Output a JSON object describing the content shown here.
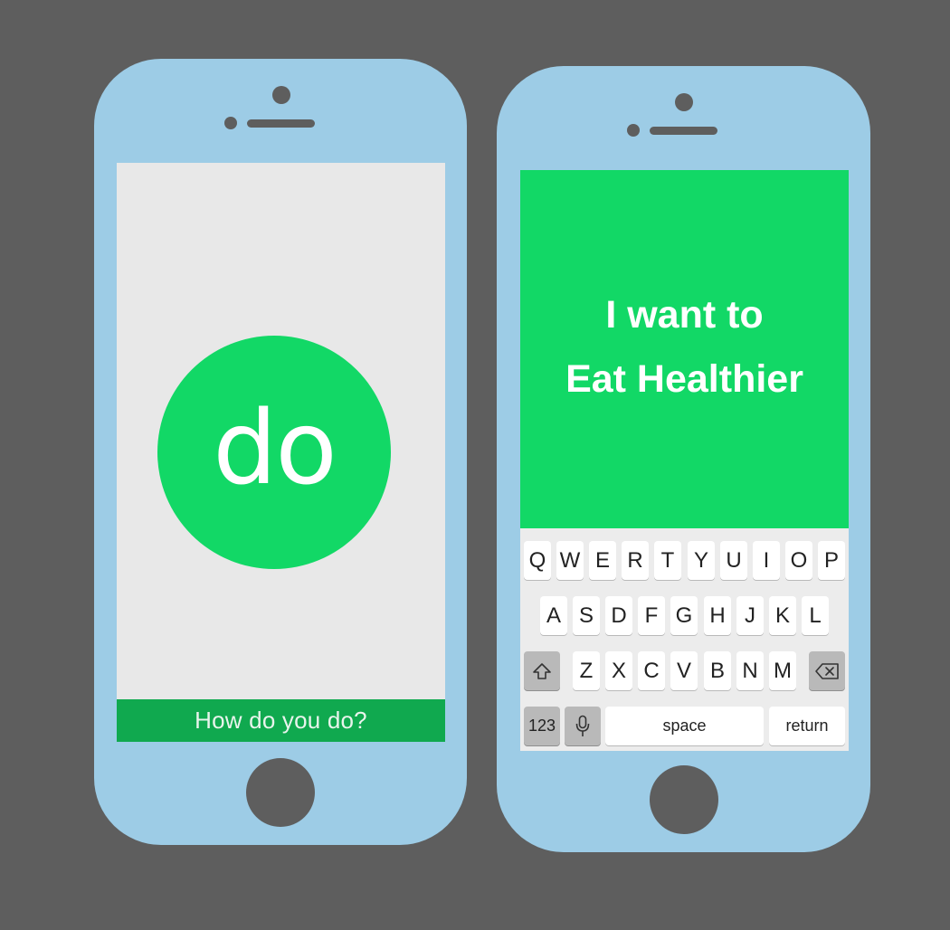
{
  "left_phone": {
    "logo": "do",
    "tagline": "How do you do?"
  },
  "right_phone": {
    "goal_line_1": "I want to",
    "goal_line_2": "Eat Healthier"
  },
  "keyboard": {
    "row1": [
      "Q",
      "W",
      "E",
      "R",
      "T",
      "Y",
      "U",
      "I",
      "O",
      "P"
    ],
    "row2": [
      "A",
      "S",
      "D",
      "F",
      "G",
      "H",
      "J",
      "K",
      "L"
    ],
    "row3": [
      "Z",
      "X",
      "C",
      "V",
      "B",
      "N",
      "M"
    ],
    "numbers_label": "123",
    "space_label": "space",
    "return_label": "return",
    "shift_icon": "shift-arrow-icon",
    "delete_icon": "backspace-icon",
    "mic_icon": "microphone-icon"
  },
  "colors": {
    "background": "#5e5e5e",
    "phone_body": "#9dcce6",
    "brand_green": "#12d866",
    "bar_green": "#10a94f",
    "screen_gray": "#e8e8e8"
  }
}
